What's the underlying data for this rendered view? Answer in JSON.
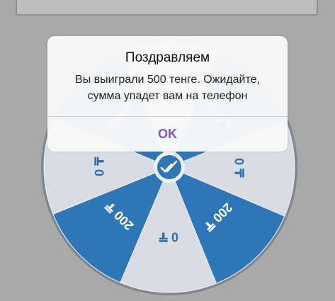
{
  "top_bar": {
    "text": ""
  },
  "wheel": {
    "segments": [
      {
        "label": "0 ₸",
        "color": "#d9dde3"
      },
      {
        "label": "200 ₸",
        "color": "#2f76b7"
      },
      {
        "label": "0 ₸",
        "color": "#d9dde3"
      },
      {
        "label": "200 ₸",
        "color": "#2f76b7"
      },
      {
        "label": "0 ₸",
        "color": "#d9dde3"
      },
      {
        "label": "200 ₸",
        "color": "#2f76b7"
      },
      {
        "label": "0 ₸",
        "color": "#d9dde3"
      },
      {
        "label": "200 ₸",
        "color": "#2f76b7"
      }
    ],
    "hub_icon": "double-check-icon"
  },
  "dialog": {
    "title": "Поздравляем",
    "message_line1": "Вы выиграли 500 тенге. Ожидайте,",
    "message_line2": "сумма упадет вам на телефон",
    "ok_label": "OK",
    "ok_color": "#7a56c9"
  }
}
